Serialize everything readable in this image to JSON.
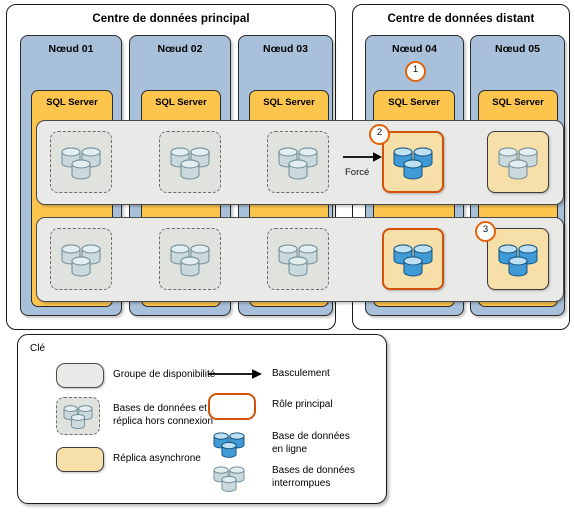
{
  "diagram": {
    "datacenters": [
      {
        "id": "primary",
        "title": "Centre de données principal",
        "nodes": [
          {
            "title": "Nœud 01",
            "sql_label": "SQL Server"
          },
          {
            "title": "Nœud 02",
            "sql_label": "SQL Server"
          },
          {
            "title": "Nœud 03",
            "sql_label": "SQL Server"
          }
        ]
      },
      {
        "id": "remote",
        "title": "Centre de données distant",
        "nodes": [
          {
            "title": "Nœud 04",
            "sql_label": "SQL Server"
          },
          {
            "title": "Nœud 05",
            "sql_label": "SQL Server"
          }
        ]
      }
    ],
    "callouts": [
      {
        "id": "1",
        "label": "1"
      },
      {
        "id": "2",
        "label": "2"
      },
      {
        "id": "3",
        "label": "3"
      }
    ],
    "arrow": {
      "label": "Forcé"
    },
    "availability_groups": [
      {
        "row": 1,
        "replicas": [
          {
            "node": "Nœud 01",
            "state": "offline",
            "db": "interrupted"
          },
          {
            "node": "Nœud 02",
            "state": "offline",
            "db": "interrupted"
          },
          {
            "node": "Nœud 03",
            "state": "offline",
            "db": "interrupted"
          },
          {
            "node": "Nœud 04",
            "state": "primary",
            "db": "online"
          },
          {
            "node": "Nœud 05",
            "state": "async",
            "db": "interrupted"
          }
        ]
      },
      {
        "row": 2,
        "replicas": [
          {
            "node": "Nœud 01",
            "state": "offline",
            "db": "interrupted"
          },
          {
            "node": "Nœud 02",
            "state": "offline",
            "db": "interrupted"
          },
          {
            "node": "Nœud 03",
            "state": "offline",
            "db": "interrupted"
          },
          {
            "node": "Nœud 04",
            "state": "primary",
            "db": "online"
          },
          {
            "node": "Nœud 05",
            "state": "async",
            "db": "online"
          }
        ]
      }
    ]
  },
  "legend": {
    "title": "Clé",
    "items": [
      {
        "key": "availability-group",
        "label": "Groupe de disponibilité"
      },
      {
        "key": "offline-replica",
        "label": "Bases de données et\nréplica hors connexion"
      },
      {
        "key": "async-replica",
        "label": "Réplica asynchrone"
      },
      {
        "key": "failover",
        "label": "Basculement"
      },
      {
        "key": "primary-role",
        "label": "Rôle principal"
      },
      {
        "key": "database-online",
        "label": "Base de données\nen ligne"
      },
      {
        "key": "database-suspended",
        "label": "Bases de données\ninterrompues"
      }
    ]
  },
  "colors": {
    "node_blue": "#a9c0da",
    "sql_orange": "#fcc54d",
    "ag_grey": "#e9e9e7",
    "async_tan": "#f6dfa9",
    "primary_border": "#d2520a",
    "db_online": "#2e86c8",
    "db_suspended": "#b9d3dd"
  }
}
